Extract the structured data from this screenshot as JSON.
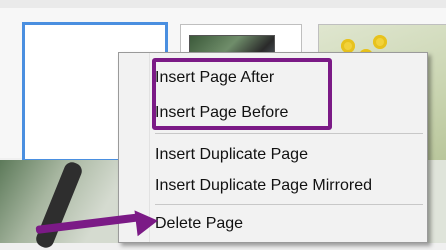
{
  "context_menu": {
    "items": [
      {
        "label": "Insert Page After"
      },
      {
        "label": "Insert Page Before"
      },
      {
        "label": "Insert Duplicate Page"
      },
      {
        "label": "Insert Duplicate Page Mirrored"
      },
      {
        "label": "Delete Page"
      }
    ]
  },
  "annotations": {
    "highlight_color": "#7b1a86",
    "selection_color": "#4a8fe0"
  }
}
